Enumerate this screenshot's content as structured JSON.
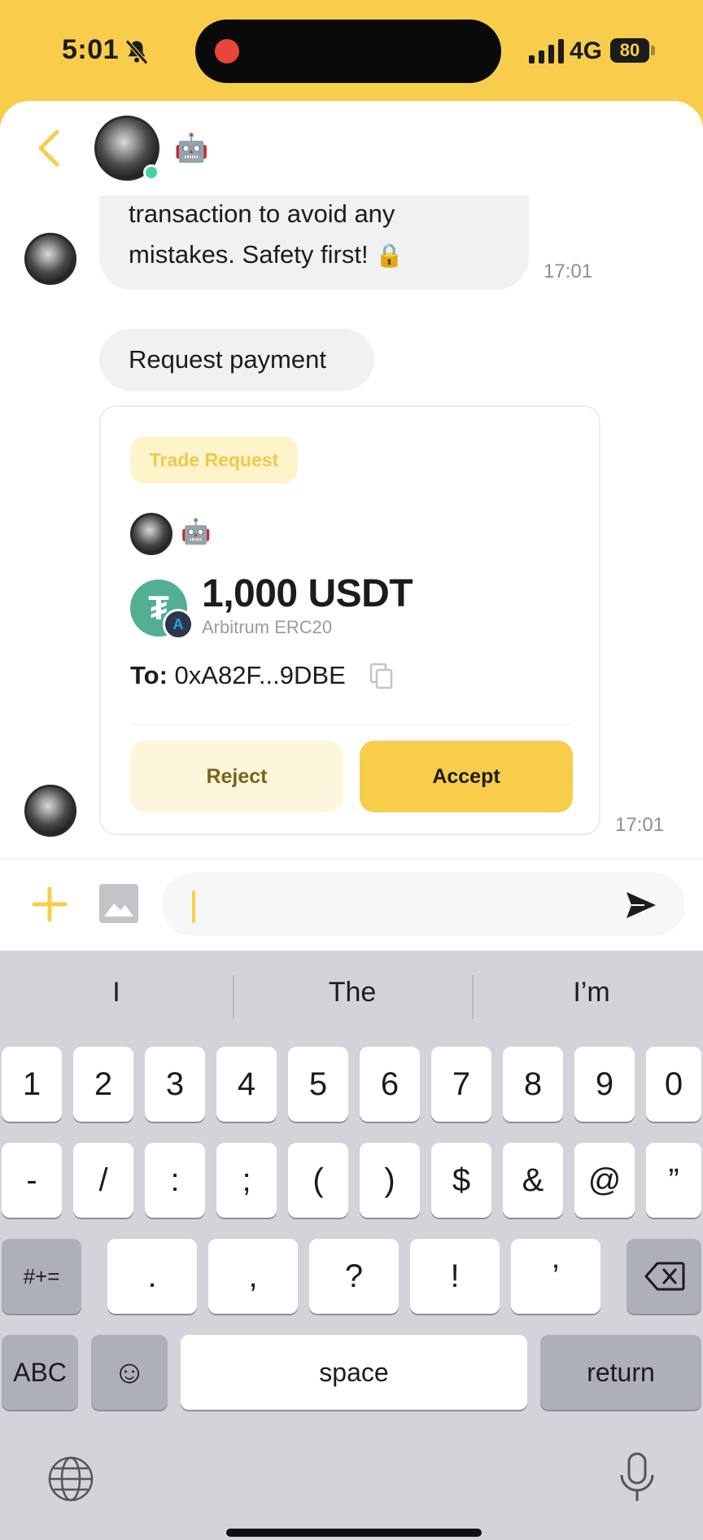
{
  "status_bar": {
    "time": "5:01",
    "network": "4G",
    "battery": "80"
  },
  "header": {
    "contact_emoji": "🤖"
  },
  "messages": [
    {
      "text_line1": "transaction to avoid any",
      "text_line2": "mistakes. Safety first!",
      "emoji": "🔒",
      "time": "17:01"
    },
    {
      "text": "Request payment"
    }
  ],
  "trade_card": {
    "tag": "Trade Request",
    "sender_emoji": "🤖",
    "amount": "1,000 USDT",
    "network": "Arbitrum ERC20",
    "to_label": "To:",
    "address": "0xA82F...9DBE",
    "reject_label": "Reject",
    "accept_label": "Accept",
    "time": "17:01"
  },
  "composer": {
    "value": ""
  },
  "keyboard": {
    "suggestions": [
      "I",
      "The",
      "I’m"
    ],
    "row1": [
      "1",
      "2",
      "3",
      "4",
      "5",
      "6",
      "7",
      "8",
      "9",
      "0"
    ],
    "row2": [
      "-",
      "/",
      ":",
      ";",
      "(",
      ")",
      "$",
      "&",
      "@",
      "”"
    ],
    "row3": [
      ".",
      ",",
      "?",
      "!",
      "’"
    ],
    "symbols_key": "#+=",
    "abc_key": "ABC",
    "emoji_key": "☺",
    "space_key": "space",
    "return_key": "return"
  },
  "colors": {
    "accent": "#f7cd4b",
    "accent_soft": "#fef6dc",
    "tether": "#53ae94",
    "online": "#3fd6a0"
  },
  "icons": [
    "back-chevron-icon",
    "bell-slash-icon",
    "signal-icon",
    "copy-icon",
    "plus-icon",
    "image-icon",
    "send-icon",
    "delete-icon",
    "globe-icon",
    "mic-icon"
  ]
}
